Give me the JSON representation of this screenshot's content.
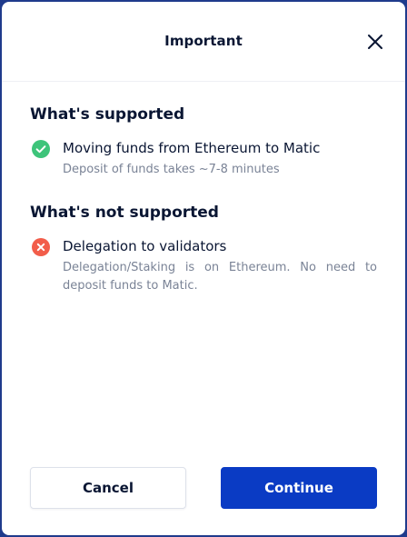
{
  "modal": {
    "title": "Important"
  },
  "supported": {
    "heading": "What's supported",
    "item": {
      "title": "Moving funds from Ethereum to Matic",
      "description": "Deposit of funds takes ~7-8 minutes",
      "icon": "check-circle-icon",
      "color": "#3ec47a"
    }
  },
  "not_supported": {
    "heading": "What's not supported",
    "item": {
      "title": "Delegation to validators",
      "description": "Delegation/Staking is on Ethereum. No need to deposit funds to Matic.",
      "icon": "x-circle-icon",
      "color": "#f25d4a"
    }
  },
  "buttons": {
    "cancel_label": "Cancel",
    "continue_label": "Continue"
  },
  "colors": {
    "primary": "#0a3bc4",
    "text": "#0a1633",
    "muted": "#7a8396"
  }
}
